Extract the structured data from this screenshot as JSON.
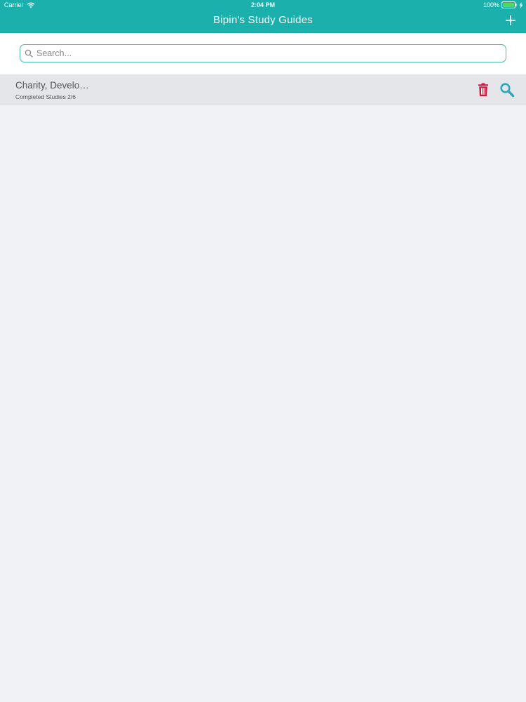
{
  "status_bar": {
    "carrier": "Carrier",
    "time": "2:04 PM",
    "battery": "100%"
  },
  "nav": {
    "title": "Bipin's Study Guides",
    "add_icon": "plus-icon"
  },
  "search": {
    "placeholder": "Search...",
    "value": ""
  },
  "guides": [
    {
      "title": "Charity, Develo…",
      "subtitle": "Completed Studies 2/6",
      "delete_icon": "trash-icon",
      "view_icon": "magnifier-icon"
    }
  ],
  "colors": {
    "header": "#1bb0ac",
    "search_border": "#49b8b2",
    "row_background": "#e5e6ea",
    "page_background": "#f1f2f6",
    "delete": "#d0183a",
    "view": "#2aa9bd",
    "battery": "#4cd964"
  }
}
